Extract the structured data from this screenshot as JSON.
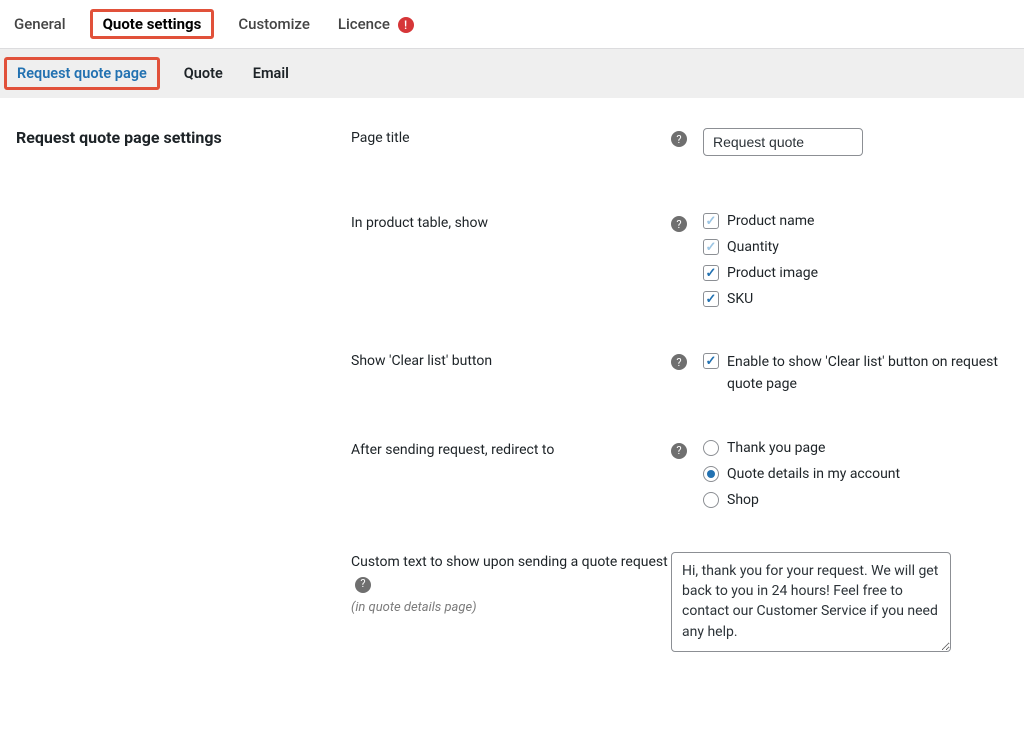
{
  "top_tabs": {
    "general": "General",
    "quote_settings": "Quote settings",
    "customize": "Customize",
    "licence": "Licence",
    "licence_alert": "!"
  },
  "sub_tabs": {
    "request_quote_page": "Request quote page",
    "quote": "Quote",
    "email": "Email"
  },
  "section_title": "Request quote page settings",
  "fields": {
    "page_title": {
      "label": "Page title",
      "value": "Request quote"
    },
    "product_table": {
      "label": "In product table, show",
      "options": {
        "product_name": "Product name",
        "quantity": "Quantity",
        "product_image": "Product image",
        "sku": "SKU"
      }
    },
    "clear_list": {
      "label": "Show 'Clear list' button",
      "option": "Enable to show 'Clear list' button on request quote page"
    },
    "redirect": {
      "label": "After sending request, redirect to",
      "options": {
        "thank_you": "Thank you page",
        "quote_details": "Quote details in my account",
        "shop": "Shop"
      }
    },
    "custom_text": {
      "label": "Custom text to show upon sending a quote request",
      "hint": "(in quote details page)",
      "value": "Hi, thank you for your request. We will get back to you in 24 hours! Feel free to contact our Customer Service if you need any help."
    }
  }
}
